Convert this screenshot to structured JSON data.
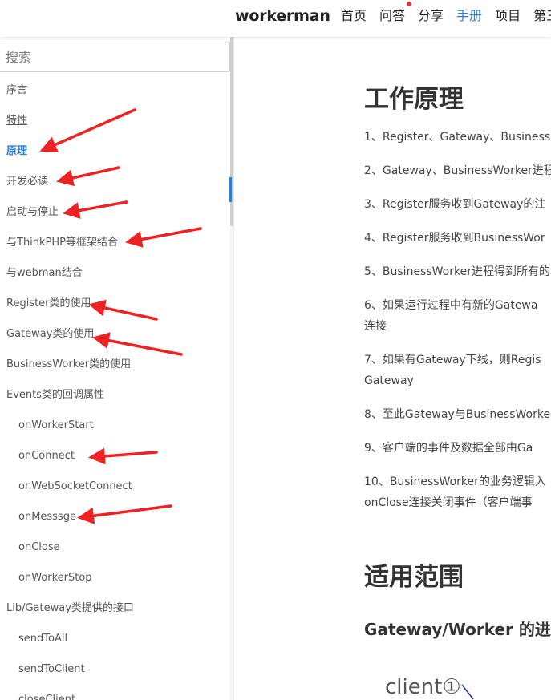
{
  "header": {
    "brand": "workerman",
    "nav": [
      {
        "label": "首页",
        "active": false
      },
      {
        "label": "问答",
        "active": false
      },
      {
        "label": "分享",
        "active": false
      },
      {
        "label": "手册",
        "active": true
      },
      {
        "label": "项目",
        "active": false
      },
      {
        "label": "第三",
        "active": false
      }
    ]
  },
  "sidebar": {
    "search_placeholder": "搜索",
    "items": [
      {
        "label": "序言",
        "level": 0
      },
      {
        "label": "特性",
        "level": 0
      },
      {
        "label": "原理",
        "level": 0,
        "active": true
      },
      {
        "label": "开发必读",
        "level": 0
      },
      {
        "label": "启动与停止",
        "level": 0
      },
      {
        "label": "与ThinkPHP等框架结合",
        "level": 0
      },
      {
        "label": "与webman结合",
        "level": 0
      },
      {
        "label": "Register类的使用",
        "level": 0
      },
      {
        "label": "Gateway类的使用",
        "level": 0
      },
      {
        "label": "BusinessWorker类的使用",
        "level": 0
      },
      {
        "label": "Events类的回调属性",
        "level": 0
      },
      {
        "label": "onWorkerStart",
        "level": 1
      },
      {
        "label": "onConnect",
        "level": 1
      },
      {
        "label": "onWebSocketConnect",
        "level": 1
      },
      {
        "label": "onMesssge",
        "level": 1
      },
      {
        "label": "onClose",
        "level": 1
      },
      {
        "label": "onWorkerStop",
        "level": 1
      },
      {
        "label": "Lib/Gateway类提供的接口",
        "level": 0
      },
      {
        "label": "sendToAll",
        "level": 1
      },
      {
        "label": "sendToClient",
        "level": 1
      },
      {
        "label": "closeClient",
        "level": 1
      }
    ]
  },
  "main": {
    "title": "工作原理",
    "steps": [
      "1、Register、Gateway、Business",
      "2、Gateway、BusinessWorker进程",
      "3、Register服务收到Gateway的注",
      "4、Register服务收到BusinessWor",
      "5、BusinessWorker进程得到所有的",
      "6、如果运行过程中有新的Gatewa",
      "连接",
      "7、如果有Gateway下线，则Regis",
      "Gateway",
      "8、至此Gateway与BusinessWorke",
      "9、客户端的事件及数据全部由Ga",
      "10、BusinessWorker的业务逻辑入",
      "onClose连接关闭事件（客户端事"
    ],
    "section_title": "适用范围",
    "subsection_title": "Gateway/Worker 的进",
    "diagram_label": "client①"
  },
  "colors": {
    "accent": "#2a7ed8",
    "annotation_arrow": "#ee2222"
  }
}
